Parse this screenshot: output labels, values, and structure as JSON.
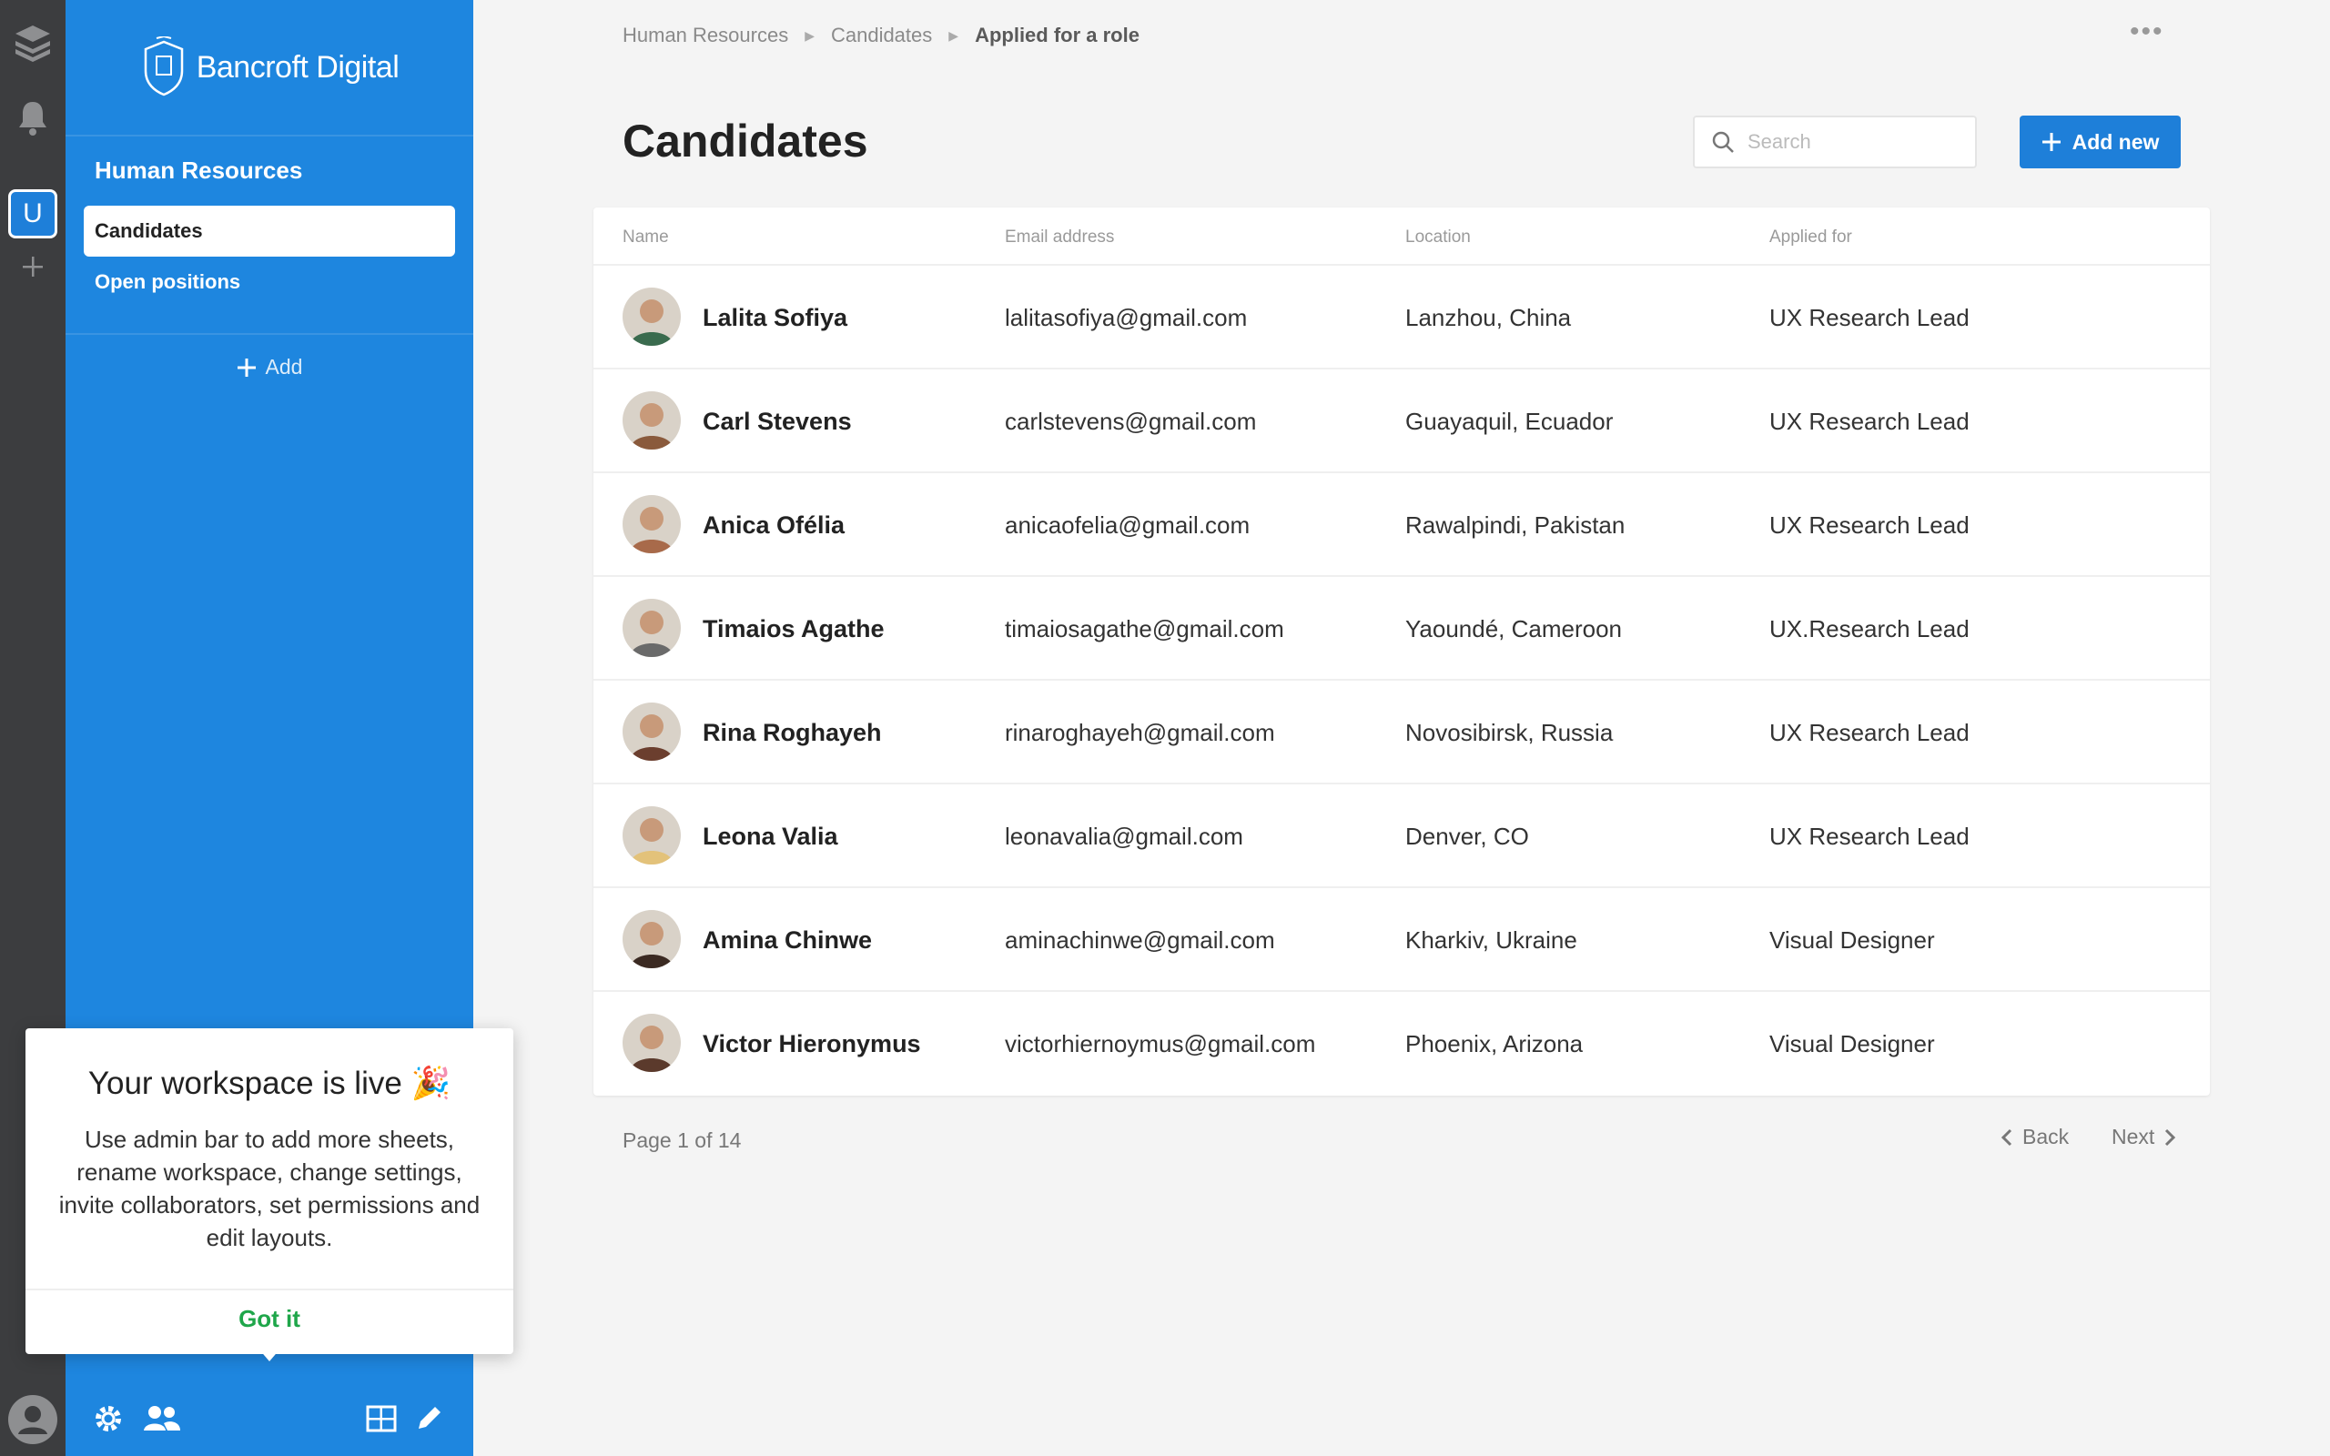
{
  "rail": {
    "workspace_letter": "U"
  },
  "sidebar": {
    "brand": "Bancroft Digital",
    "section_title": "Human Resources",
    "items": [
      {
        "label": "Candidates",
        "active": true
      },
      {
        "label": "Open positions",
        "active": false
      }
    ],
    "add_label": "Add"
  },
  "breadcrumb": [
    "Human Resources",
    "Candidates",
    "Applied for a role"
  ],
  "page": {
    "title": "Candidates",
    "search_placeholder": "Search",
    "add_button": "Add new"
  },
  "table": {
    "columns": [
      "Name",
      "Email address",
      "Location",
      "Applied for"
    ],
    "rows": [
      {
        "name": "Lalita Sofiya",
        "email": "lalitasofiya@gmail.com",
        "location": "Lanzhou, China",
        "applied_for": "UX Research Lead",
        "avatar_color": "#3a6b4e"
      },
      {
        "name": "Carl Stevens",
        "email": "carlstevens@gmail.com",
        "location": "Guayaquil, Ecuador",
        "applied_for": "UX Research Lead",
        "avatar_color": "#8a5a3c"
      },
      {
        "name": "Anica Ofélia",
        "email": "anicaofelia@gmail.com",
        "location": "Rawalpindi, Pakistan",
        "applied_for": "UX Research Lead",
        "avatar_color": "#a86a4a"
      },
      {
        "name": "Timaios Agathe",
        "email": "timaiosagathe@gmail.com",
        "location": "Yaoundé, Cameroon",
        "applied_for": "UX.Research Lead",
        "avatar_color": "#6a6a6a"
      },
      {
        "name": "Rina Roghayeh",
        "email": "rinaroghayeh@gmail.com",
        "location": "Novosibirsk, Russia",
        "applied_for": "UX Research Lead",
        "avatar_color": "#6b3e2e"
      },
      {
        "name": "Leona Valia",
        "email": "leonavalia@gmail.com",
        "location": "Denver, CO",
        "applied_for": "UX Research Lead",
        "avatar_color": "#e3c27a"
      },
      {
        "name": "Amina Chinwe",
        "email": "aminachinwe@gmail.com",
        "location": "Kharkiv, Ukraine",
        "applied_for": "Visual Designer",
        "avatar_color": "#3b2a22"
      },
      {
        "name": "Victor Hieronymus",
        "email": "victorhiernoymus@gmail.com",
        "location": "Phoenix, Arizona",
        "applied_for": "Visual Designer",
        "avatar_color": "#5b3a2c"
      }
    ]
  },
  "pagination": {
    "info": "Page 1 of 14",
    "back": "Back",
    "next": "Next"
  },
  "popover": {
    "title": "Your workspace is live",
    "title_icon": "🎉",
    "body": "Use admin bar to add more sheets, rename workspace, change settings, invite collaborators, set permissions and edit layouts.",
    "button": "Got it"
  },
  "colors": {
    "rail": "#3c3d3f",
    "sidebar": "#1e86df",
    "accent": "#1e7fd9",
    "success": "#1fa64a"
  }
}
